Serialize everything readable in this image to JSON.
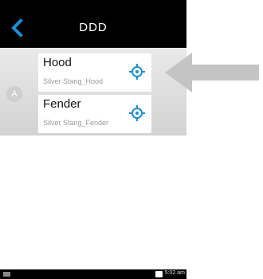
{
  "header": {
    "title": "DDD",
    "back_icon": "chevron-left-icon",
    "accent_color": "#1a8fd1"
  },
  "list": {
    "section_letter": "A",
    "items": [
      {
        "name": "Hood",
        "subtitle": "Silver Stang_Hood",
        "icon": "crosshair-target-icon"
      },
      {
        "name": "Fender",
        "subtitle": "Silver Stang_Fender",
        "icon": "crosshair-target-icon"
      }
    ]
  },
  "status": {
    "time": "5:02 am"
  },
  "annotation": {
    "icon": "arrow-left-icon",
    "color": "#c4c4c4"
  }
}
